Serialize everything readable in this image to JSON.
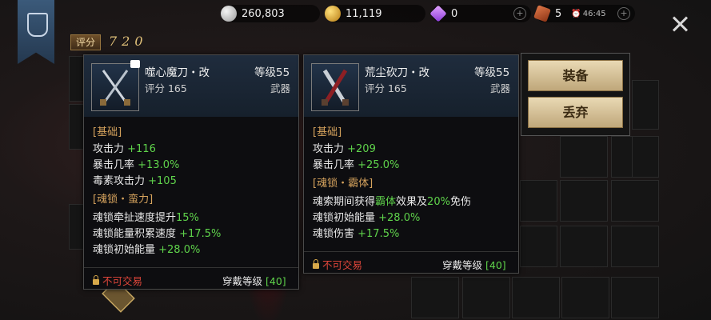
{
  "currencies": [
    {
      "icon": "silver-coin-icon",
      "value": "260,803"
    },
    {
      "icon": "gold-coin-icon",
      "value": "11,119"
    },
    {
      "icon": "diamond-icon",
      "value": "0"
    },
    {
      "icon": "ticket-icon",
      "value": "5",
      "timer": "46:45"
    }
  ],
  "score": {
    "label": "评分",
    "value": "720"
  },
  "cards": [
    {
      "name": "噬心魔刀・改",
      "level": "等级55",
      "rating": "评分 165",
      "type": "武器",
      "sections": [
        {
          "title": "[基础]",
          "lines": [
            {
              "label": "攻击力 ",
              "value": "+116"
            },
            {
              "label": "暴击几率 ",
              "value": "+13.0%"
            },
            {
              "label": "毒素攻击力 ",
              "value": "+105"
            }
          ]
        },
        {
          "title": "[魂锁・蛮力]",
          "lines": [
            {
              "label": "魂锁牵扯速度提升",
              "value": "15%"
            },
            {
              "label": "魂锁能量积累速度 ",
              "value": "+17.5%"
            },
            {
              "label": "魂锁初始能量 ",
              "value": "+28.0%"
            }
          ]
        }
      ],
      "trade": "不可交易",
      "wear": "穿戴等级",
      "wear_level": "[40]"
    },
    {
      "name": "荒尘砍刀・改",
      "level": "等级55",
      "rating": "评分 165",
      "type": "武器",
      "sections": [
        {
          "title": "[基础]",
          "lines": [
            {
              "label": "攻击力 ",
              "value": "+209"
            },
            {
              "label": "暴击几率 ",
              "value": "+25.0%"
            }
          ]
        },
        {
          "title": "[魂锁・霸体]",
          "lines": [
            {
              "label": "魂索期间获得",
              "value": "霸体",
              "label2": "效果及",
              "value2": "20%",
              "label3": "免伤"
            },
            {
              "label": "魂锁初始能量 ",
              "value": "+28.0%"
            },
            {
              "label": "魂锁伤害 ",
              "value": "+17.5%"
            }
          ]
        }
      ],
      "trade": "不可交易",
      "wear": "穿戴等级",
      "wear_level": "[40]"
    }
  ],
  "menu": {
    "equip": "装备",
    "discard": "丢弃"
  },
  "colors": {
    "section": "#d6a35d",
    "bonus": "#5fd34b",
    "warning": "#e0463a",
    "button": "#e9d9b4"
  }
}
